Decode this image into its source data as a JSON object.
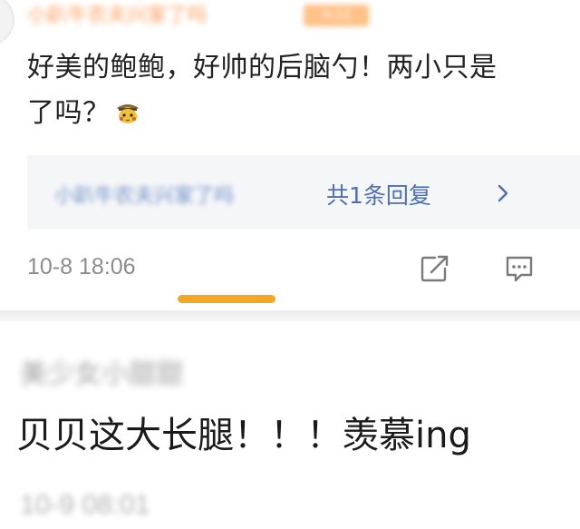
{
  "comment1": {
    "username": "小趴牛农夫兴家了吗",
    "badge": "lv.12",
    "text_line1": "好美的鲍鲍，好帅的后脑勺！两小只是",
    "text_line2": "了吗？",
    "emoji": "pikachu-detective-emoji",
    "reply_preview": {
      "name": "小趴牛农夫兴家了吗",
      "count": "共1条回复"
    },
    "timestamp": "10-8 18:06"
  },
  "comment2": {
    "username": "美少女小甜甜",
    "text": "贝贝这大长腿！！！羡慕ing",
    "timestamp": "10-9 08:01"
  },
  "colors": {
    "accent": "#f5a623",
    "link": "#4d6fb8",
    "text": "#222222",
    "muted": "#8c8c8c",
    "reply_bg": "#f5f6f8"
  },
  "icons": [
    "share-icon",
    "comment-icon",
    "chevron-right-icon",
    "pikachu-detective-emoji"
  ]
}
